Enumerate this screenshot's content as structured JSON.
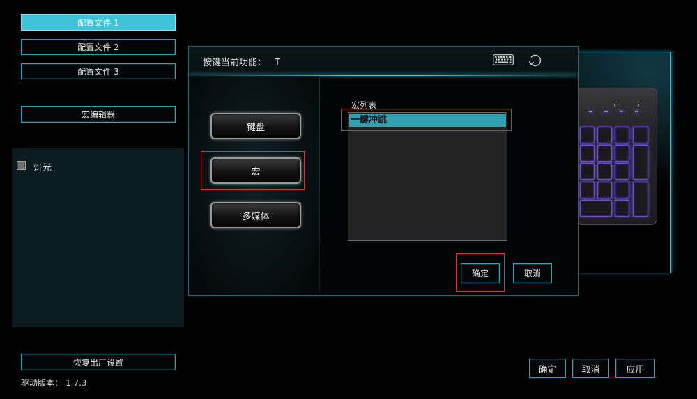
{
  "sidebar": {
    "profiles": [
      {
        "label": "配置文件 1",
        "active": true
      },
      {
        "label": "配置文件 2",
        "active": false
      },
      {
        "label": "配置文件 3",
        "active": false
      }
    ],
    "macro_editor_label": "宏编辑器",
    "lighting": {
      "label": "灯光",
      "checked": false
    },
    "reset_label": "恢复出厂设置",
    "version_label": "驱动版本：",
    "version_value": "1.7.3"
  },
  "dialog": {
    "current_function_label": "按键当前功能：",
    "current_function_value": "T",
    "header_icons": [
      "keyboard-icon",
      "refresh-icon"
    ],
    "categories": [
      {
        "label": "键盘",
        "selected": false
      },
      {
        "label": "宏",
        "selected": true
      },
      {
        "label": "多媒体",
        "selected": false
      }
    ],
    "macro_list_label": "宏列表",
    "macro_list": [
      {
        "label": "一鍵冲跳",
        "selected": true
      }
    ],
    "ok_label": "确定",
    "cancel_label": "取消"
  },
  "footer": {
    "ok_label": "确定",
    "cancel_label": "取消",
    "apply_label": "应用"
  },
  "colors": {
    "accent": "#3ec3da",
    "button_border": "#28a3bb",
    "selection": "#2fa2b4",
    "annotation_red": "#e03232",
    "key_backlight": "#7b5cff"
  }
}
